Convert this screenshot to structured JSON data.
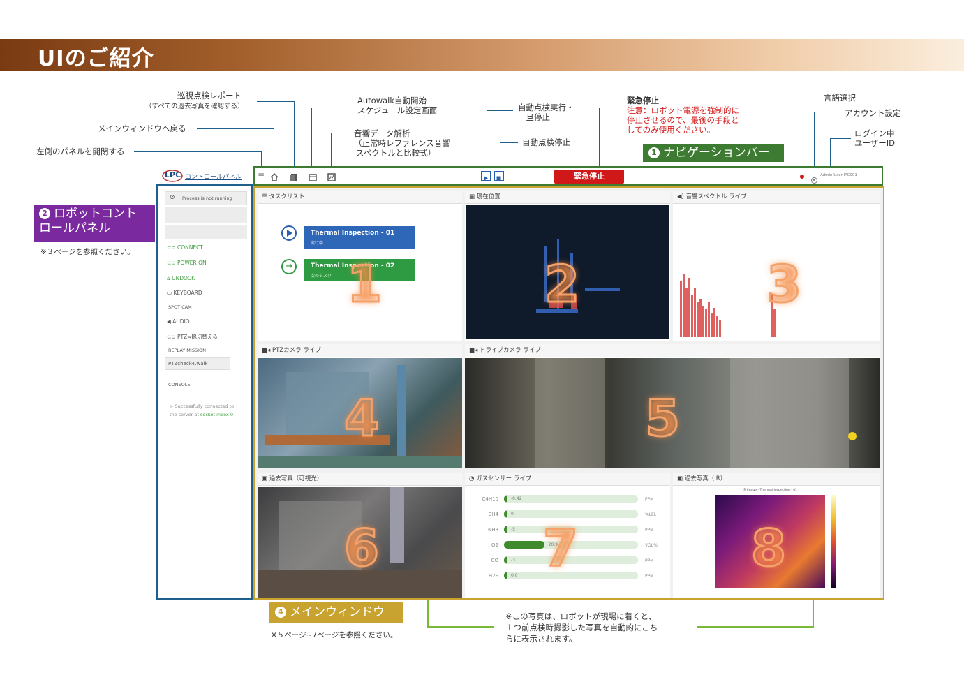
{
  "header": {
    "title": "UIのご紹介"
  },
  "annotations": {
    "patrol_report": "巡視点検レポート",
    "patrol_report_sub": "（すべての過去写真を確認する）",
    "back_main": "メインウィンドウへ戻る",
    "toggle_panel": "左側のパネルを開閉する",
    "autowalk_1": "Autowalk自動開始",
    "autowalk_2": "スケジュール設定画面",
    "audio_1": "音響データ解析",
    "audio_2": "（正常時レファレンス音響",
    "audio_3": "スペクトルと比較式）",
    "auto_run_1": "自動点検実行・",
    "auto_run_2": "一旦停止",
    "auto_stop": "自動点検停止",
    "estop_title": "緊急停止",
    "estop_1": "注意：ロボット電源を強制的に",
    "estop_2": "停止させるので、最後の手段と",
    "estop_3": "してのみ使用ください。",
    "lang": "言語選択",
    "account": "アカウント設定",
    "login_1": "ログイン中",
    "login_2": "ユーザーID",
    "ref_left": "※３ページを参照ください。",
    "ref_bottom": "※５ページ~7ページを参照ください。",
    "photo_note_1": "※この写真は、ロボットが現場に着くと、",
    "photo_note_2": "１つ前点検時撮影した写真を自動的にこち",
    "photo_note_3": "らに表示されます。"
  },
  "tags": {
    "nav": {
      "num": "1",
      "label": "ナビゲーションバー",
      "color": "#3d7a32"
    },
    "robot_panel": {
      "num": "2",
      "label_1": "ロボットコント",
      "label_2": "ロールパネル",
      "color": "#7a2a9e"
    },
    "main_window": {
      "num": "4",
      "label": "メインウィンドウ",
      "color": "#c9a330"
    }
  },
  "navbar": {
    "logo": "LPC",
    "control_panel": "コントロールパネル",
    "estop_button": "緊急停止",
    "user": "Admin User IPC001"
  },
  "left_panel": {
    "status": "Process is not running",
    "connect": "CONNECT",
    "power_on": "POWER ON",
    "undock": "UNDOCK",
    "keyboard": "KEYBOARD",
    "spot_cam": "SPOT CAM",
    "audio": "AUDIO",
    "ptz_ir": "PTZ⇔IR切替える",
    "replay_mission": "REPLAY MISSION",
    "mission_file": "PTZcheck4.walk",
    "console": "CONSOLE",
    "console_1": "> Successfully connected to",
    "console_2": "the server at",
    "console_3": "socket index 0"
  },
  "panels": {
    "p1": {
      "title": "タスクリスト",
      "num": "1",
      "task1": "Thermal Inspection - 01",
      "task1_status": "実行中",
      "task2": "Thermal Inspection - 02",
      "task2_status": "次のタスク"
    },
    "p2": {
      "title": "現在位置",
      "num": "2"
    },
    "p3": {
      "title": "音響スペクトル ライブ",
      "num": "3"
    },
    "p4": {
      "title": "PTZカメラ ライブ",
      "num": "4"
    },
    "p5": {
      "title": "ドライブカメラ ライブ",
      "num": "5"
    },
    "p6": {
      "title": "過去写真（可視光）",
      "num": "6"
    },
    "p7": {
      "title": "ガスセンサー ライブ",
      "num": "7"
    },
    "p8": {
      "title": "過去写真（IR）",
      "num": "8",
      "plot_title": "IR Image - Thermal Inspection - 01"
    }
  },
  "gas_sensors": [
    {
      "name": "C4H10",
      "value": "-0.42",
      "unit": "PPM",
      "fill": 0.02
    },
    {
      "name": "CH4",
      "value": "0",
      "unit": "%LEL",
      "fill": 0.0
    },
    {
      "name": "NH3",
      "value": "-5",
      "unit": "PPM",
      "fill": 0.02
    },
    {
      "name": "O2",
      "value": "20.9",
      "unit": "VOL%",
      "fill": 0.3
    },
    {
      "name": "CO",
      "value": "-3",
      "unit": "PPM",
      "fill": 0.02
    },
    {
      "name": "H2S",
      "value": "0.0",
      "unit": "PPM",
      "fill": 0.0
    }
  ]
}
